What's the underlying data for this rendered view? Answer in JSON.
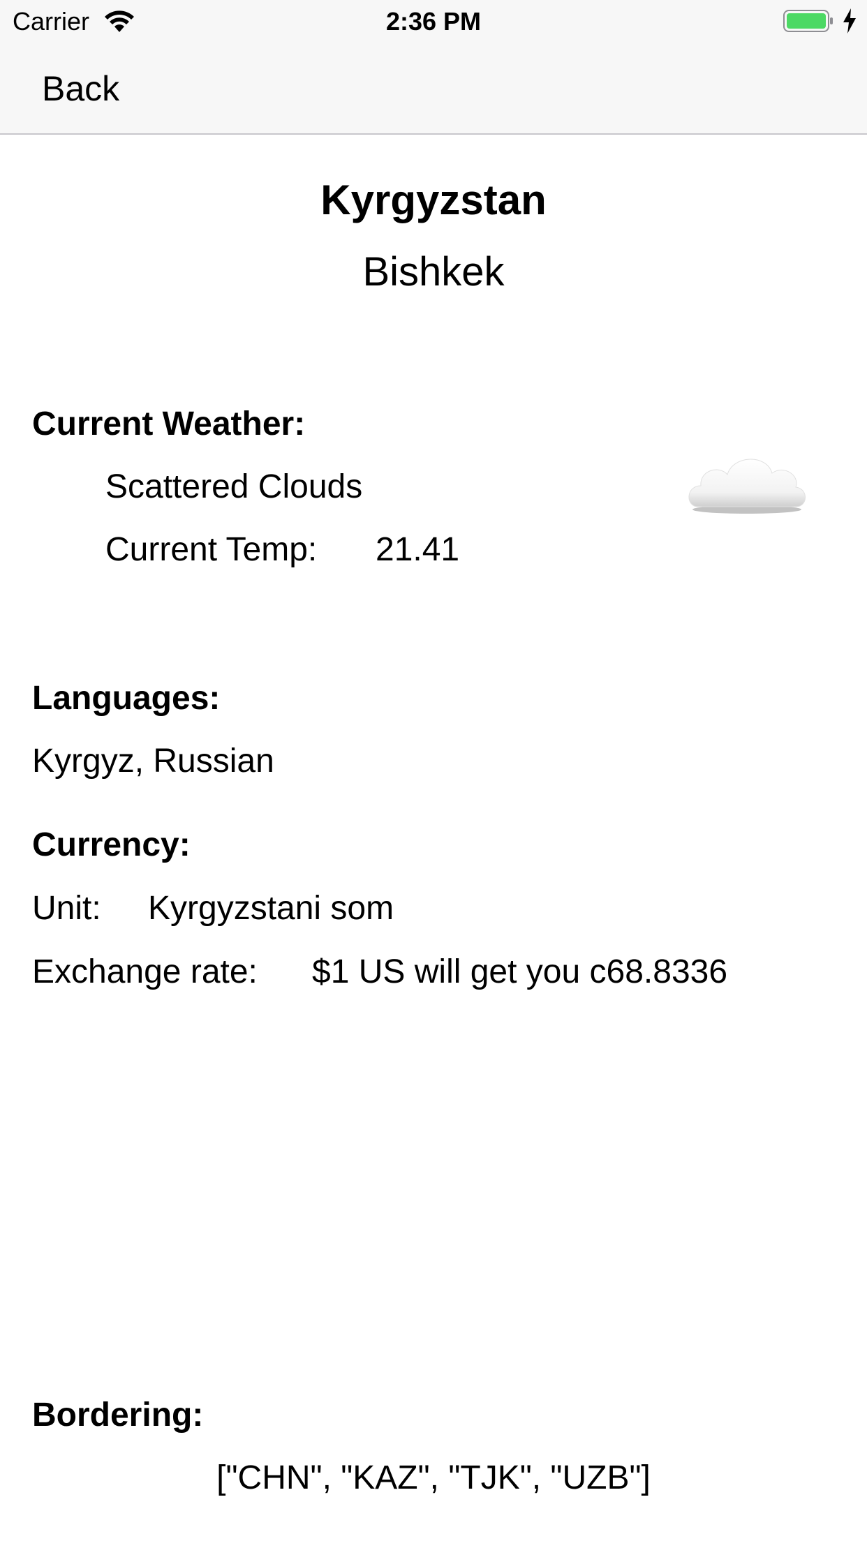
{
  "status_bar": {
    "carrier": "Carrier",
    "time": "2:36 PM",
    "battery_color": "#4cd964",
    "icons": [
      "wifi-icon",
      "battery-icon",
      "charging-icon"
    ]
  },
  "nav": {
    "back_label": "Back"
  },
  "country": {
    "name": "Kyrgyzstan",
    "capital": "Bishkek"
  },
  "weather": {
    "header": "Current Weather:",
    "description": "Scattered Clouds",
    "temp_label": "Current Temp:",
    "temp_value": "21.41",
    "icon": "cloud-icon"
  },
  "languages": {
    "header": "Languages:",
    "value": "Kyrgyz, Russian"
  },
  "currency": {
    "header": "Currency:",
    "unit_label": "Unit:",
    "unit_value": "Kyrgyzstani som",
    "rate_label": "Exchange rate:",
    "rate_value": "$1 US will get you c68.8336"
  },
  "bordering": {
    "header": "Bordering:",
    "value": "[\"CHN\", \"KAZ\", \"TJK\", \"UZB\"]"
  }
}
